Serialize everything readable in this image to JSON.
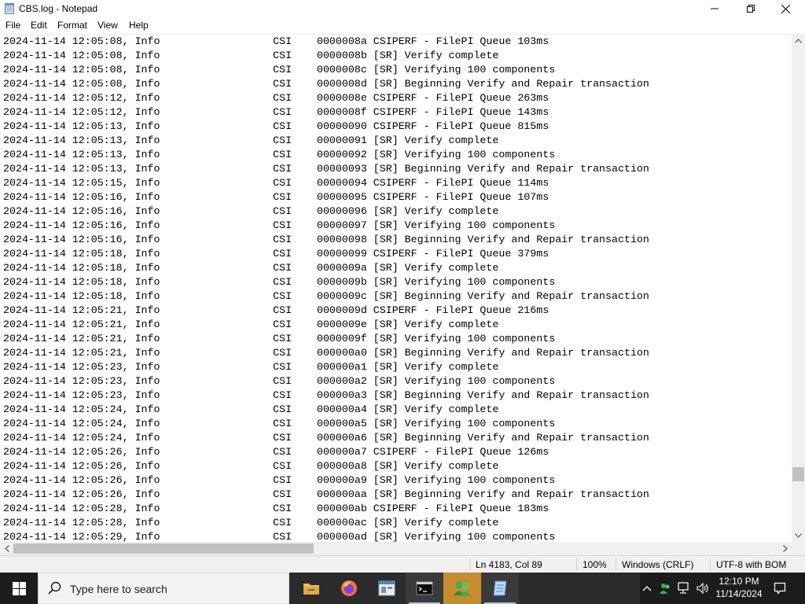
{
  "window": {
    "title": "CBS.log - Notepad",
    "icon": "notepad-icon"
  },
  "menu": [
    {
      "label": "File"
    },
    {
      "label": "Edit"
    },
    {
      "label": "Format"
    },
    {
      "label": "View"
    },
    {
      "label": "Help"
    }
  ],
  "editor": {
    "lines": [
      "2024-11-14 12:05:08, Info                  CSI    0000008a CSIPERF - FilePI Queue 103ms",
      "2024-11-14 12:05:08, Info                  CSI    0000008b [SR] Verify complete",
      "2024-11-14 12:05:08, Info                  CSI    0000008c [SR] Verifying 100 components",
      "2024-11-14 12:05:08, Info                  CSI    0000008d [SR] Beginning Verify and Repair transaction",
      "2024-11-14 12:05:12, Info                  CSI    0000008e CSIPERF - FilePI Queue 263ms",
      "2024-11-14 12:05:12, Info                  CSI    0000008f CSIPERF - FilePI Queue 143ms",
      "2024-11-14 12:05:13, Info                  CSI    00000090 CSIPERF - FilePI Queue 815ms",
      "2024-11-14 12:05:13, Info                  CSI    00000091 [SR] Verify complete",
      "2024-11-14 12:05:13, Info                  CSI    00000092 [SR] Verifying 100 components",
      "2024-11-14 12:05:13, Info                  CSI    00000093 [SR] Beginning Verify and Repair transaction",
      "2024-11-14 12:05:15, Info                  CSI    00000094 CSIPERF - FilePI Queue 114ms",
      "2024-11-14 12:05:16, Info                  CSI    00000095 CSIPERF - FilePI Queue 107ms",
      "2024-11-14 12:05:16, Info                  CSI    00000096 [SR] Verify complete",
      "2024-11-14 12:05:16, Info                  CSI    00000097 [SR] Verifying 100 components",
      "2024-11-14 12:05:16, Info                  CSI    00000098 [SR] Beginning Verify and Repair transaction",
      "2024-11-14 12:05:18, Info                  CSI    00000099 CSIPERF - FilePI Queue 379ms",
      "2024-11-14 12:05:18, Info                  CSI    0000009a [SR] Verify complete",
      "2024-11-14 12:05:18, Info                  CSI    0000009b [SR] Verifying 100 components",
      "2024-11-14 12:05:18, Info                  CSI    0000009c [SR] Beginning Verify and Repair transaction",
      "2024-11-14 12:05:21, Info                  CSI    0000009d CSIPERF - FilePI Queue 216ms",
      "2024-11-14 12:05:21, Info                  CSI    0000009e [SR] Verify complete",
      "2024-11-14 12:05:21, Info                  CSI    0000009f [SR] Verifying 100 components",
      "2024-11-14 12:05:21, Info                  CSI    000000a0 [SR] Beginning Verify and Repair transaction",
      "2024-11-14 12:05:23, Info                  CSI    000000a1 [SR] Verify complete",
      "2024-11-14 12:05:23, Info                  CSI    000000a2 [SR] Verifying 100 components",
      "2024-11-14 12:05:23, Info                  CSI    000000a3 [SR] Beginning Verify and Repair transaction",
      "2024-11-14 12:05:24, Info                  CSI    000000a4 [SR] Verify complete",
      "2024-11-14 12:05:24, Info                  CSI    000000a5 [SR] Verifying 100 components",
      "2024-11-14 12:05:24, Info                  CSI    000000a6 [SR] Beginning Verify and Repair transaction",
      "2024-11-14 12:05:26, Info                  CSI    000000a7 CSIPERF - FilePI Queue 126ms",
      "2024-11-14 12:05:26, Info                  CSI    000000a8 [SR] Verify complete",
      "2024-11-14 12:05:26, Info                  CSI    000000a9 [SR] Verifying 100 components",
      "2024-11-14 12:05:26, Info                  CSI    000000aa [SR] Beginning Verify and Repair transaction",
      "2024-11-14 12:05:28, Info                  CSI    000000ab CSIPERF - FilePI Queue 183ms",
      "2024-11-14 12:05:28, Info                  CSI    000000ac [SR] Verify complete",
      "2024-11-14 12:05:29, Info                  CSI    000000ad [SR] Verifying 100 components"
    ]
  },
  "statusbar": {
    "position": "Ln 4183, Col 89",
    "zoom": "100%",
    "line_ending": "Windows (CRLF)",
    "encoding": "UTF-8 with BOM"
  },
  "taskbar": {
    "search_placeholder": "Type here to search",
    "apps": [
      {
        "name": "file-explorer-icon"
      },
      {
        "name": "firefox-icon"
      },
      {
        "name": "window-app-icon"
      },
      {
        "name": "terminal-icon"
      },
      {
        "name": "users-app-icon"
      },
      {
        "name": "notepad-icon"
      }
    ],
    "clock_time": "12:10 PM",
    "clock_date": "11/14/2024"
  }
}
